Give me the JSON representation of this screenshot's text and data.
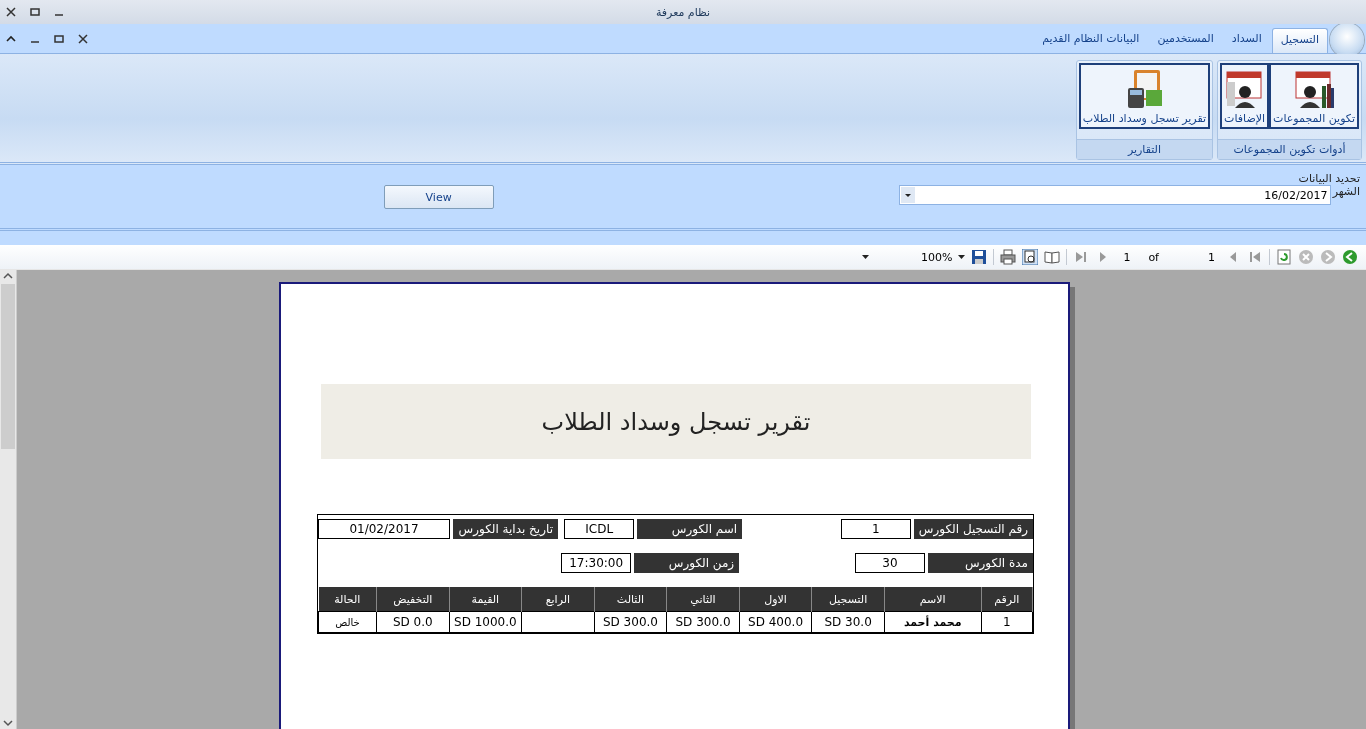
{
  "window": {
    "title": "نظام معرفة"
  },
  "ribbon": {
    "tabs": [
      {
        "label": "التسجيل",
        "selected": true
      },
      {
        "label": "السداد",
        "selected": false
      },
      {
        "label": "المستخدمين",
        "selected": false
      },
      {
        "label": "البيانات النظام القديم",
        "selected": false
      }
    ],
    "groups": [
      {
        "title": "أدوات تكوين المجموعات",
        "buttons": [
          "تكوين المجموعات",
          "الإضافات"
        ]
      },
      {
        "title": "التقارير",
        "buttons": [
          "تقرير تسجل وسداد الطلاب"
        ]
      }
    ]
  },
  "filter": {
    "group_title": "تحديد البيانات",
    "month_label": "الشهر",
    "month_value": "16/02/2017",
    "view_button": "View"
  },
  "report_toolbar": {
    "page_current": "1",
    "page_of": "of",
    "page_total": "1",
    "zoom": "100%"
  },
  "report": {
    "title": "تقرير تسجل وسداد الطلاب",
    "field_rows": [
      [
        {
          "label": "رقم التسجيل الكورس",
          "value": "1"
        },
        {
          "label": "اسم الكورس",
          "value": "ICDL"
        },
        {
          "label": "تاريخ بداية الكورس",
          "value": "01/02/2017"
        }
      ],
      [
        {
          "label": "مدة الكورس",
          "value": "30"
        },
        {
          "label": "زمن الكورس",
          "value": "17:30:00"
        }
      ]
    ],
    "table": {
      "columns": [
        "الرقم",
        "الاسم",
        "التسجيل",
        "الاول",
        "الثاني",
        "الثالث",
        "الرابع",
        "القيمة",
        "التخفيض",
        "الحالة"
      ],
      "rows": [
        [
          "1",
          "محمد أحمد",
          "SD 30.0",
          "SD 400.0",
          "SD 300.0",
          "SD 300.0",
          "",
          "SD 1000.0",
          "SD 0.0",
          "خالص"
        ]
      ]
    }
  }
}
